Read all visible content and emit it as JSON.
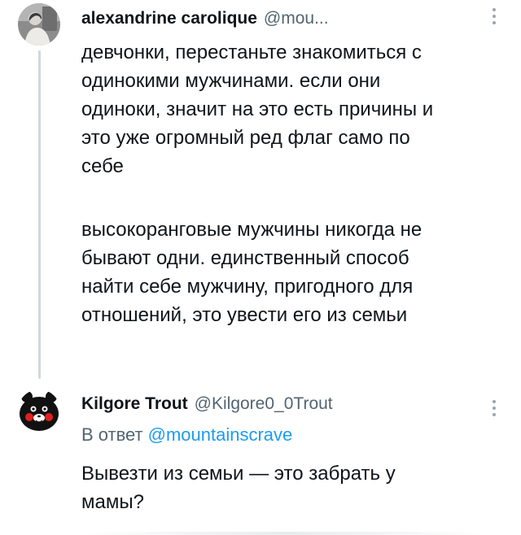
{
  "tweets": [
    {
      "author": {
        "name": "alexandrine carolique",
        "handle": "@mou..."
      },
      "paragraphs": [
        "девчонки, перестаньте знакомиться с\nодинокими мужчинами. если они\nодиноки, значит на это есть причины и\nэто уже огромный ред флаг само по\nсебе",
        "высокоранговые мужчины никогда не\nбывают одни. единственный способ\nнайти себе мужчину, пригодного для\nотношений, это увести его из семьи"
      ]
    },
    {
      "author": {
        "name": "Kilgore Trout",
        "handle": "@Kilgore0_0Trout"
      },
      "reply_to": {
        "prefix": "В ответ",
        "handle": "@mountainscrave"
      },
      "paragraphs": [
        "Вывезти из семьи — это забрать у\nмамы?"
      ]
    }
  ],
  "icons": {
    "more": "more-vertical-icon"
  },
  "colors": {
    "text": "#0f1419",
    "secondary": "#536471",
    "link": "#1d9bf0",
    "thread_line": "#cfd9de"
  }
}
